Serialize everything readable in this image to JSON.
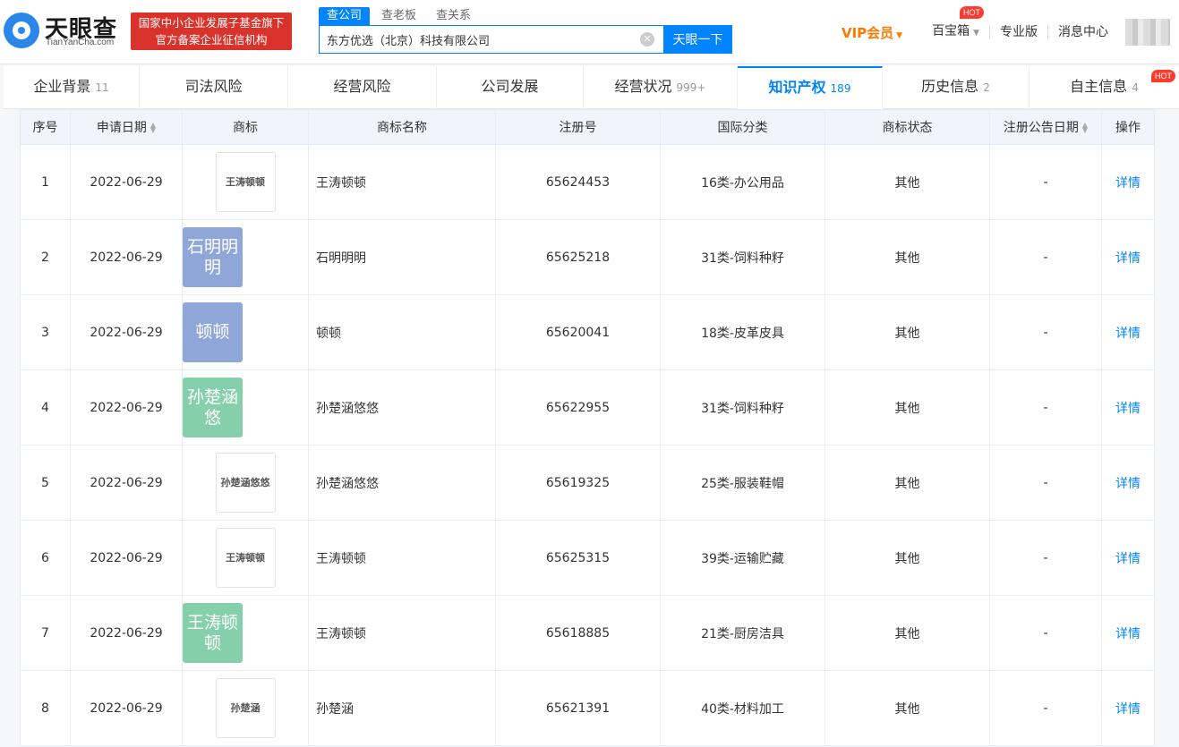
{
  "header": {
    "logo_cn": "天眼查",
    "logo_en": "TianYanCha.com",
    "gov_badge_line1": "国家中小企业发展子基金旗下",
    "gov_badge_line2": "官方备案企业征信机构",
    "search_tabs": [
      "查公司",
      "查老板",
      "查关系"
    ],
    "search_value": "东方优选（北京）科技有限公司",
    "search_button": "天眼一下",
    "vip_label": "VIP会员",
    "links": [
      {
        "label": "百宝箱",
        "badge": "HOT"
      },
      {
        "label": "专业版"
      },
      {
        "label": "消息中心"
      }
    ]
  },
  "tabs": [
    {
      "label": "企业背景",
      "count": "11"
    },
    {
      "label": "司法风险",
      "count": ""
    },
    {
      "label": "经营风险",
      "count": ""
    },
    {
      "label": "公司发展",
      "count": ""
    },
    {
      "label": "经营状况",
      "count": "999+"
    },
    {
      "label": "知识产权",
      "count": "189"
    },
    {
      "label": "历史信息",
      "count": "2"
    },
    {
      "label": "自主信息",
      "count": "4",
      "badge": "HOT"
    }
  ],
  "table": {
    "columns": [
      "序号",
      "申请日期",
      "商标",
      "商标名称",
      "注册号",
      "国际分类",
      "商标状态",
      "注册公告日期",
      "操作"
    ],
    "rows": [
      {
        "no": "1",
        "date": "2022-06-29",
        "logo_text": "王涛顿顿",
        "logo_style": "plain",
        "name": "王涛顿顿",
        "reg": "65624453",
        "cls": "16类-办公用品",
        "status": "其他",
        "pub": "-",
        "action": "详情"
      },
      {
        "no": "2",
        "date": "2022-06-29",
        "logo_text": "石明明明",
        "logo_style": "blue",
        "name": "石明明明",
        "reg": "65625218",
        "cls": "31类-饲料种籽",
        "status": "其他",
        "pub": "-",
        "action": "详情"
      },
      {
        "no": "3",
        "date": "2022-06-29",
        "logo_text": "顿顿",
        "logo_style": "blue",
        "name": "顿顿",
        "reg": "65620041",
        "cls": "18类-皮革皮具",
        "status": "其他",
        "pub": "-",
        "action": "详情"
      },
      {
        "no": "4",
        "date": "2022-06-29",
        "logo_text": "孙楚涵悠",
        "logo_style": "green",
        "name": "孙楚涵悠悠",
        "reg": "65622955",
        "cls": "31类-饲料种籽",
        "status": "其他",
        "pub": "-",
        "action": "详情"
      },
      {
        "no": "5",
        "date": "2022-06-29",
        "logo_text": "孙楚涵悠悠",
        "logo_style": "plain",
        "name": "孙楚涵悠悠",
        "reg": "65619325",
        "cls": "25类-服装鞋帽",
        "status": "其他",
        "pub": "-",
        "action": "详情"
      },
      {
        "no": "6",
        "date": "2022-06-29",
        "logo_text": "王涛顿顿",
        "logo_style": "plain",
        "name": "王涛顿顿",
        "reg": "65625315",
        "cls": "39类-运输贮藏",
        "status": "其他",
        "pub": "-",
        "action": "详情"
      },
      {
        "no": "7",
        "date": "2022-06-29",
        "logo_text": "王涛顿顿",
        "logo_style": "green",
        "name": "王涛顿顿",
        "reg": "65618885",
        "cls": "21类-厨房洁具",
        "status": "其他",
        "pub": "-",
        "action": "详情"
      },
      {
        "no": "8",
        "date": "2022-06-29",
        "logo_text": "孙楚涵",
        "logo_style": "plain",
        "name": "孙楚涵",
        "reg": "65621391",
        "cls": "40类-材料加工",
        "status": "其他",
        "pub": "-",
        "action": "详情"
      }
    ]
  }
}
